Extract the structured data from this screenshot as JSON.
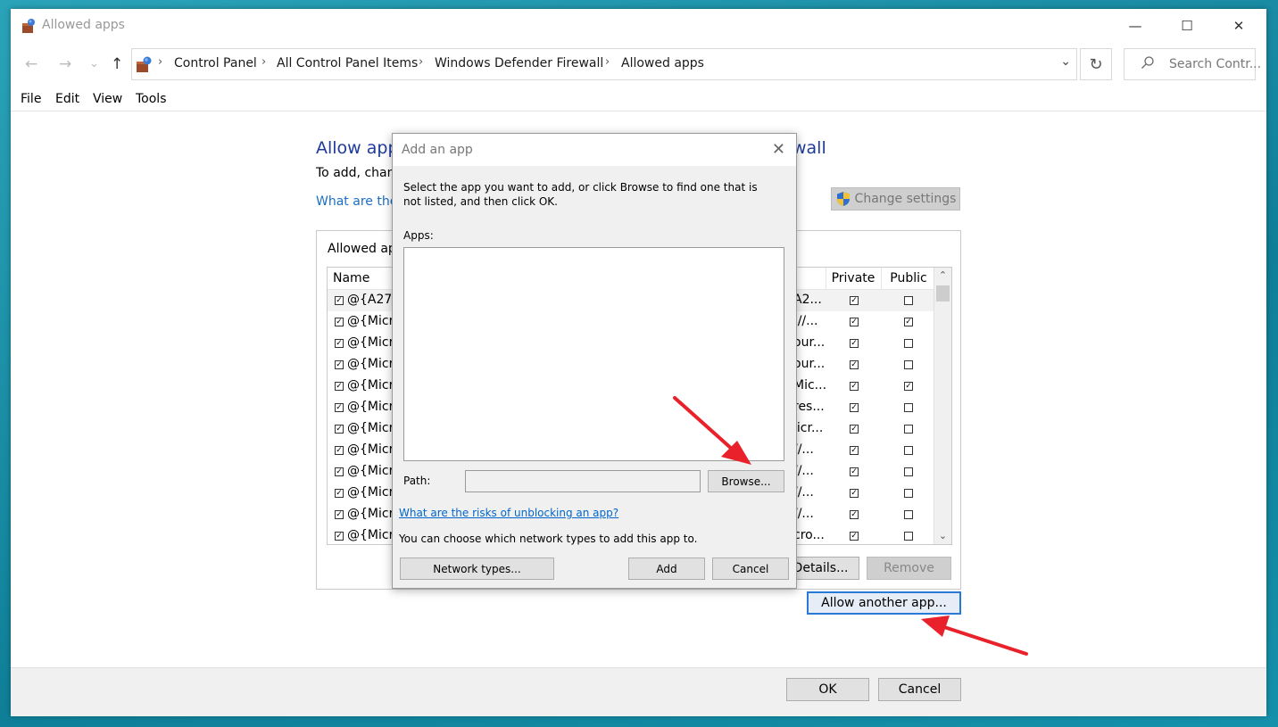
{
  "window": {
    "title": "Allowed apps",
    "controls": {
      "minimize": "—",
      "maximize": "☐",
      "close": "✕"
    }
  },
  "nav": {
    "back": "←",
    "forward": "→",
    "recent": "⌄",
    "up": "↑",
    "breadcrumbs": [
      "Control Panel",
      "All Control Panel Items",
      "Windows Defender Firewall",
      "Allowed apps"
    ],
    "separator": "›",
    "dropdown": "⌄",
    "refresh": "↻",
    "search_placeholder": "Search Contr..."
  },
  "menu": [
    "File",
    "Edit",
    "View",
    "Tools"
  ],
  "main": {
    "heading_start": "Allow app",
    "heading_end": "wall",
    "subtext": "To add, chan",
    "what_link": "What are the",
    "change_settings": "Change settings",
    "group_label": "Allowed ap",
    "columns": {
      "name": "Name",
      "private": "Private",
      "public": "Public"
    },
    "rows": [
      {
        "name": "@{A278",
        "desc": "A2...",
        "checked": true,
        "private": true,
        "public": false,
        "selected": true
      },
      {
        "name": "@{Micro",
        "desc": "://...",
        "checked": true,
        "private": true,
        "public": true,
        "selected": false
      },
      {
        "name": "@{Micro",
        "desc": "our...",
        "checked": true,
        "private": true,
        "public": false,
        "selected": false
      },
      {
        "name": "@{Micro",
        "desc": "our...",
        "checked": true,
        "private": true,
        "public": false,
        "selected": false
      },
      {
        "name": "@{Micro",
        "desc": "Mic...",
        "checked": true,
        "private": true,
        "public": true,
        "selected": false
      },
      {
        "name": "@{Micro",
        "desc": "res...",
        "checked": true,
        "private": true,
        "public": false,
        "selected": false
      },
      {
        "name": "@{Micro",
        "desc": "licr...",
        "checked": true,
        "private": true,
        "public": false,
        "selected": false
      },
      {
        "name": "@{Micro",
        "desc": "//...",
        "checked": true,
        "private": true,
        "public": false,
        "selected": false
      },
      {
        "name": "@{Micro",
        "desc": "//...",
        "checked": true,
        "private": true,
        "public": false,
        "selected": false
      },
      {
        "name": "@{Micro",
        "desc": "//...",
        "checked": true,
        "private": true,
        "public": false,
        "selected": false
      },
      {
        "name": "@{Micro",
        "desc": "//...",
        "checked": true,
        "private": true,
        "public": false,
        "selected": false
      },
      {
        "name": "@{Micro",
        "desc": "cro...",
        "checked": true,
        "private": true,
        "public": false,
        "selected": false
      }
    ],
    "details_btn": "Details...",
    "remove_btn": "Remove",
    "allow_another_btn": "Allow another app..."
  },
  "footer": {
    "ok": "OK",
    "cancel": "Cancel"
  },
  "dialog": {
    "title": "Add an app",
    "close": "✕",
    "instruction": "Select the app you want to add, or click Browse to find one that is not listed, and then click OK.",
    "apps_label": "Apps:",
    "path_label": "Path:",
    "browse": "Browse...",
    "risk_link": "What are the risks of unblocking an app?",
    "network_text": "You can choose which network types to add this app to.",
    "network_types": "Network types...",
    "add": "Add",
    "cancel": "Cancel"
  },
  "colors": {
    "heading": "#1e3a9c",
    "link": "#0066cc",
    "annotation_arrow": "#e8212a"
  }
}
